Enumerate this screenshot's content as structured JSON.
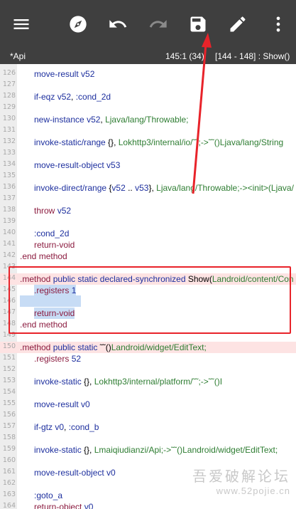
{
  "toolbar": {
    "icons": [
      "menu-icon",
      "compass-icon",
      "undo-icon",
      "redo-icon",
      "save-icon",
      "edit-icon",
      "more-vert-icon"
    ],
    "colors": {
      "background": "#3f3f3f",
      "icon": "#ffffff",
      "icon_disabled": "#8a8a8a"
    }
  },
  "infobar": {
    "file_name": "*Api",
    "cursor_position": "145:1 (34)",
    "method_range": "[144 - 148] : Show()"
  },
  "editor": {
    "lines": [
      {
        "num": "126",
        "html": "<span class='op'>move-result</span> <span class='reg'>v52</span>"
      },
      {
        "num": "127",
        "html": ""
      },
      {
        "num": "128",
        "html": "<span class='op'>if-eqz</span> <span class='reg'>v52</span>, <span class='lbl'>:cond_2d</span>"
      },
      {
        "num": "129",
        "html": ""
      },
      {
        "num": "130",
        "html": "<span class='op'>new-instance</span> <span class='reg'>v52</span>, <span class='ty'>Ljava/lang/Throwable;</span>"
      },
      {
        "num": "131",
        "html": ""
      },
      {
        "num": "132",
        "html": "<span class='op'>invoke-static/range</span> {}, <span class='ty'>Lokhttp3/internal/io/˜˜;-&gt;˜˜()Ljava/lang/String</span>"
      },
      {
        "num": "133",
        "html": ""
      },
      {
        "num": "134",
        "html": "<span class='op'>move-result-object</span> <span class='reg'>v53</span>"
      },
      {
        "num": "135",
        "html": ""
      },
      {
        "num": "136",
        "html": "<span class='op'>invoke-direct/range</span> {<span class='reg'>v52</span> .. <span class='reg'>v53</span>}, <span class='ty'>Ljava/lang/Throwable;-&gt;&lt;init&gt;(Ljava/</span>"
      },
      {
        "num": "137",
        "html": ""
      },
      {
        "num": "138",
        "html": "<span class='k'>throw</span> <span class='reg'>v52</span>"
      },
      {
        "num": "139",
        "html": ""
      },
      {
        "num": "140",
        "html": "<span class='lbl'>:cond_2d</span>"
      },
      {
        "num": "141",
        "html": "<span class='k'>return-void</span>"
      },
      {
        "num": "142",
        "html": "<span class='k'>.end</span> <span class='k'>method</span>"
      },
      {
        "num": "143",
        "html": ""
      },
      {
        "num": "144",
        "html": "<span class='k'>.method</span> <span class='op'>public</span> <span class='op'>static</span> <span class='op'>declared-synchronized</span> Show(<span class='ty'>Landroid/content/Con</span>"
      },
      {
        "num": "145",
        "html": "<span class='sel'><span class='k'>.registers</span> <span class='reg'>1</span></span>"
      },
      {
        "num": "146",
        "html": ""
      },
      {
        "num": "147",
        "html": "<span class='sel'><span class='k'>return-void</span></span>"
      },
      {
        "num": "148",
        "html": "<span class='k'>.end</span> <span class='k'>method</span>"
      },
      {
        "num": "149",
        "html": ""
      },
      {
        "num": "150",
        "html": "<span class='k'>.method</span> <span class='op'>public</span> <span class='op'>static</span> ˜˜()<span class='ty'>Landroid/widget/EditText;</span>"
      },
      {
        "num": "151",
        "html": "<span class='k'>.registers</span> <span class='reg'>52</span>"
      },
      {
        "num": "152",
        "html": ""
      },
      {
        "num": "153",
        "html": "<span class='op'>invoke-static</span> {}, <span class='ty'>Lokhttp3/internal/platform/˜˜;-&gt;˜˜()I</span>"
      },
      {
        "num": "154",
        "html": ""
      },
      {
        "num": "155",
        "html": "<span class='op'>move-result</span> <span class='reg'>v0</span>"
      },
      {
        "num": "156",
        "html": ""
      },
      {
        "num": "157",
        "html": "<span class='op'>if-gtz</span> <span class='reg'>v0</span>, <span class='lbl'>:cond_b</span>"
      },
      {
        "num": "158",
        "html": ""
      },
      {
        "num": "159",
        "html": "<span class='op'>invoke-static</span> {}, <span class='ty'>Lmaiqiudianzi/Api;-&gt;˜˜()Landroid/widget/EditText;</span>"
      },
      {
        "num": "160",
        "html": ""
      },
      {
        "num": "161",
        "html": "<span class='op'>move-result-object</span> <span class='reg'>v0</span>"
      },
      {
        "num": "162",
        "html": ""
      },
      {
        "num": "163",
        "html": "<span class='lbl'>:goto_a</span>"
      },
      {
        "num": "164",
        "html": "<span class='k'>return-object</span> <span class='reg'>v0</span>"
      }
    ]
  },
  "watermark": {
    "line1": "吾爱破解论坛",
    "line2": "www.52pojie.cn"
  },
  "annotation_colors": {
    "red": "#e8232a"
  }
}
